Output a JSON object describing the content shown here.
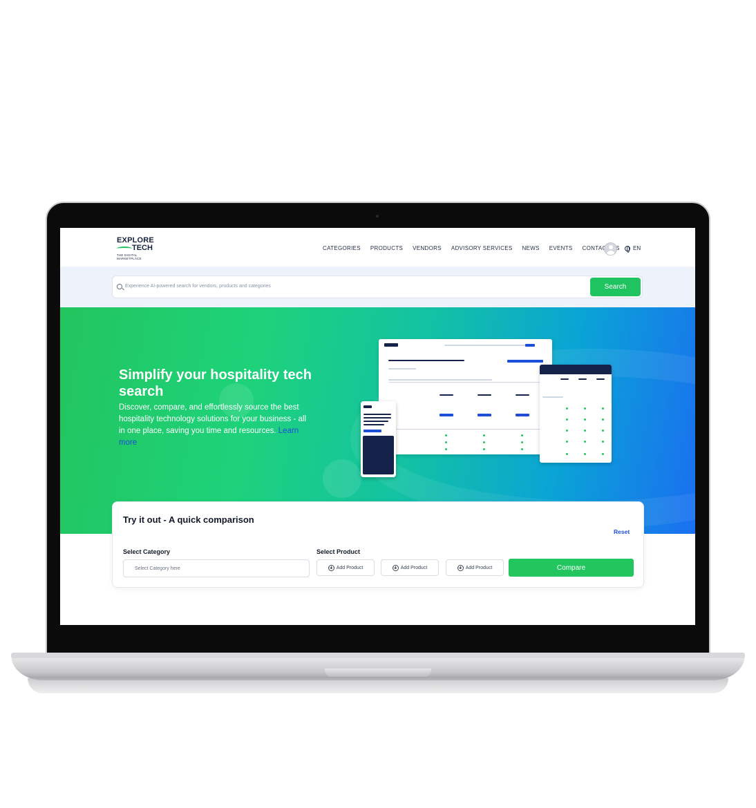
{
  "brand": {
    "logo_line1": "EXPLORE",
    "logo_line2": "TECH",
    "logo_tagline": "THE DIGITAL MARKETPLACE",
    "accent_green": "#22c55e",
    "accent_blue": "#1d4ed8",
    "navy": "#152249"
  },
  "nav": {
    "items": [
      "CATEGORIES",
      "PRODUCTS",
      "VENDORS",
      "ADVISORY SERVICES",
      "NEWS",
      "EVENTS",
      "CONTACT US"
    ],
    "language": "EN"
  },
  "search": {
    "placeholder": "Experience AI-powered search for vendors, products and categories",
    "button_label": "Search"
  },
  "hero": {
    "title": "Simplify your hospitality tech search",
    "description": "Discover, compare, and effortlessly source the best hospitality technology solutions for your business - all in one place, saving you time and resources.",
    "learn_more": "Learn more"
  },
  "comparison": {
    "title": "Try it out - A quick comparison",
    "reset_label": "Reset",
    "category_label": "Select Category",
    "category_placeholder": "Select Category here",
    "product_label": "Select Product",
    "add_product_labels": [
      "Add Product",
      "Add Product",
      "Add Product"
    ],
    "compare_label": "Compare"
  }
}
